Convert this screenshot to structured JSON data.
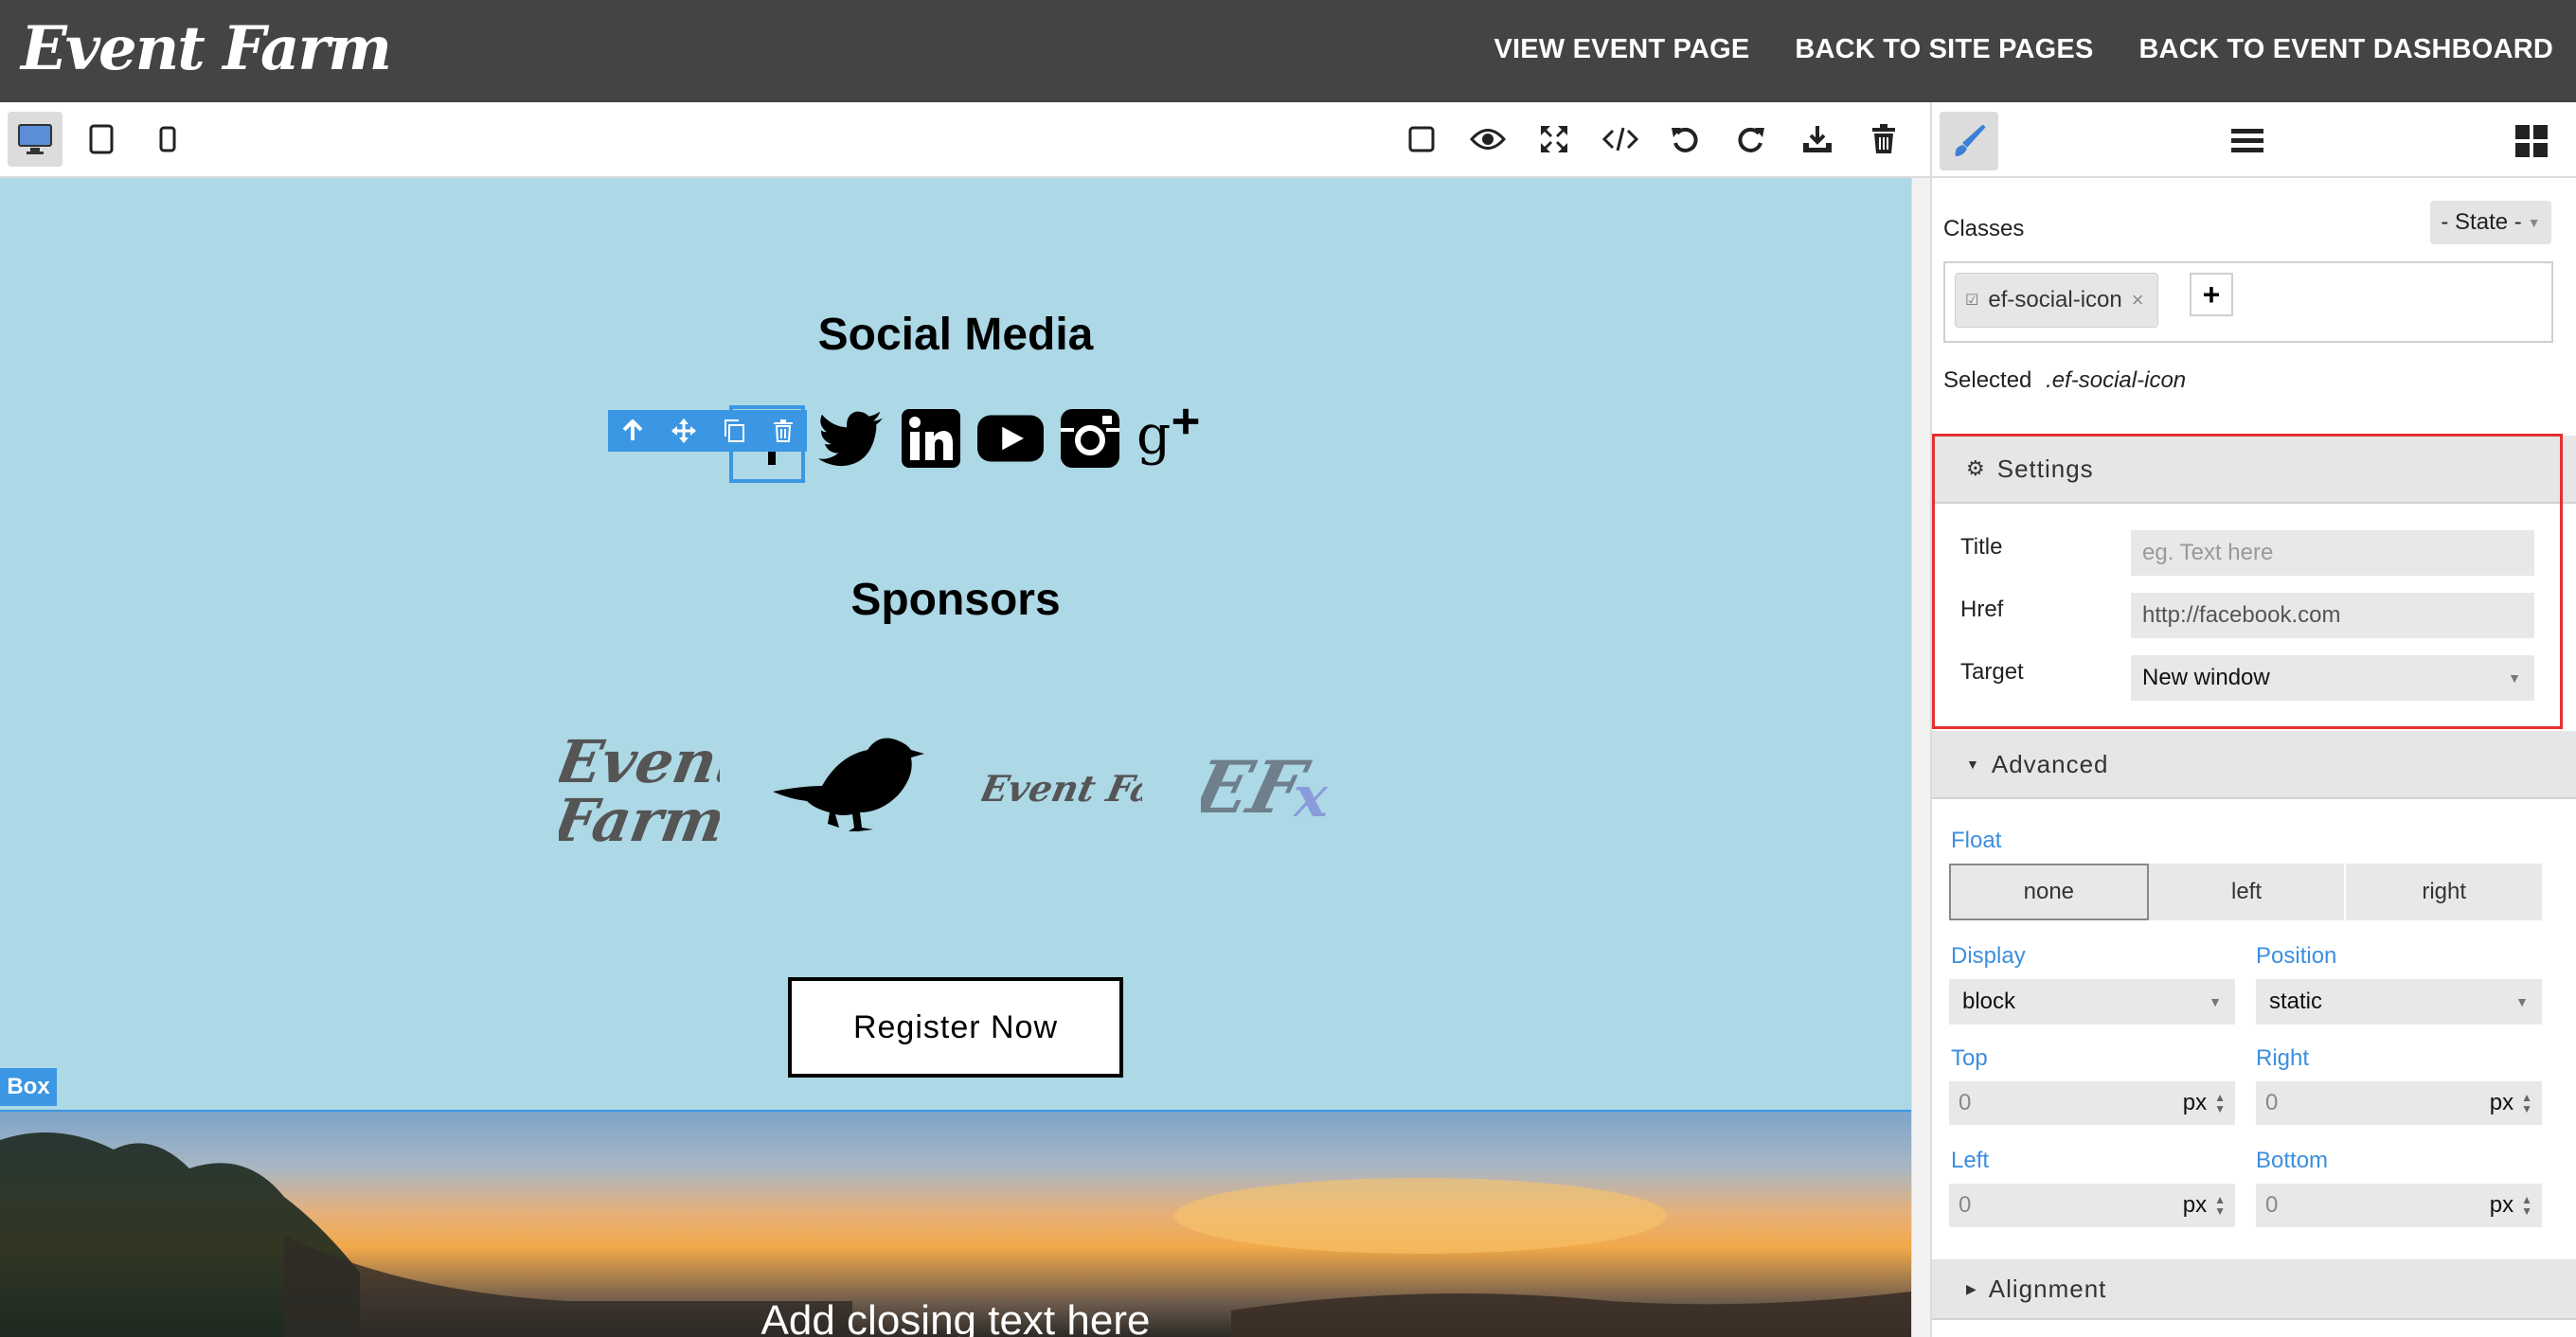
{
  "brand": "Event Farm",
  "topnav": [
    "VIEW EVENT PAGE",
    "BACK TO SITE PAGES",
    "BACK TO EVENT DASHBOARD"
  ],
  "canvas": {
    "social_heading": "Social Media",
    "sponsors_heading": "Sponsors",
    "sponsors": [
      "Event Farm",
      "Event Farm",
      "EFx"
    ],
    "register_label": "Register Now",
    "box_label": "Box",
    "closing_text": "Add closing text here"
  },
  "panel": {
    "classes_label": "Classes",
    "state_label": "- State -",
    "class_tag": "ef-social-icon",
    "add_label": "+",
    "selected_label": "Selected",
    "selected_value": ".ef-social-icon",
    "settings": {
      "title": "Settings",
      "title_label": "Title",
      "title_placeholder": "eg. Text here",
      "href_label": "Href",
      "href_value": "http://facebook.com",
      "target_label": "Target",
      "target_value": "New window"
    },
    "advanced": {
      "title": "Advanced",
      "float_label": "Float",
      "float_options": [
        "none",
        "left",
        "right"
      ],
      "display_label": "Display",
      "display_value": "block",
      "position_label": "Position",
      "position_value": "static",
      "top_label": "Top",
      "top_value": "0",
      "right_label": "Right",
      "right_value": "0",
      "left_label": "Left",
      "left_value": "0",
      "bottom_label": "Bottom",
      "bottom_value": "0",
      "unit": "px"
    },
    "alignment_title": "Alignment"
  },
  "colors": {
    "accent": "#3b97e3",
    "canvas_bg": "#add8e6",
    "highlight": "#e53030",
    "topbar": "#444444"
  }
}
